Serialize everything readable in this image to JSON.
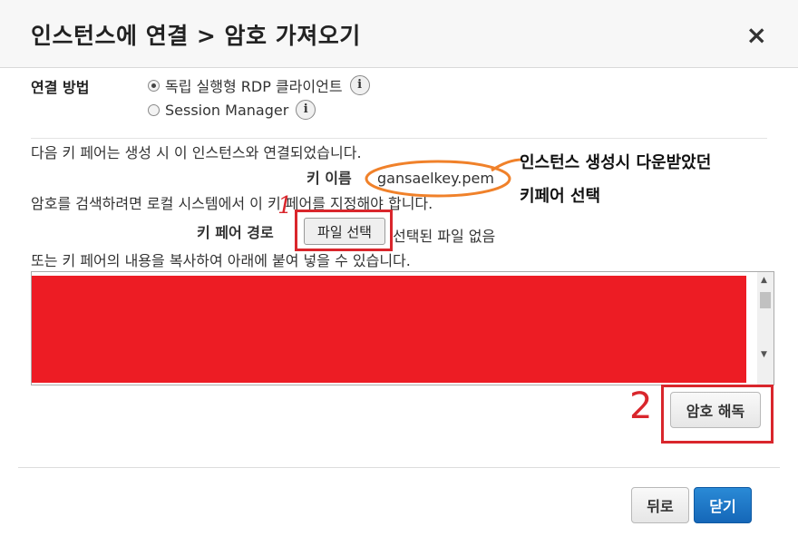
{
  "dialog": {
    "title": "인스턴스에 연결 > 암호 가져오기",
    "close_symbol": "×"
  },
  "connection": {
    "label": "연결 방법",
    "options": [
      {
        "label": "독립 실행형 RDP 클라이언트",
        "selected": true
      },
      {
        "label": "Session Manager",
        "selected": false
      }
    ],
    "info_symbol": "i"
  },
  "body": {
    "line1": "다음 키 페어는 생성 시 이 인스턴스와 연결되었습니다.",
    "key_name_label": "키 이름",
    "key_name_value": "gansaelkey.pem",
    "line2": "암호를 검색하려면 로컬 시스템에서 이 키 페어를 지정해야 합니다.",
    "key_path_label": "키 페어 경로",
    "file_button": "파일 선택",
    "no_file_text": "선택된 파일 없음",
    "line3": "또는 키 페어의 내용을 복사하여 아래에 붙여 넣을 수 있습니다."
  },
  "textarea": {
    "scroll_up": "▲",
    "scroll_down": "▼"
  },
  "buttons": {
    "decrypt": "암호 해독",
    "back": "뒤로",
    "close": "닫기"
  },
  "annotations": {
    "note_line1": "인스턴스 생성시 다운받았던",
    "note_line2": "키페어 선택",
    "marker1": "1",
    "marker2": "2",
    "highlight_color": "#d9262c",
    "ellipse_color": "#f0812a"
  }
}
